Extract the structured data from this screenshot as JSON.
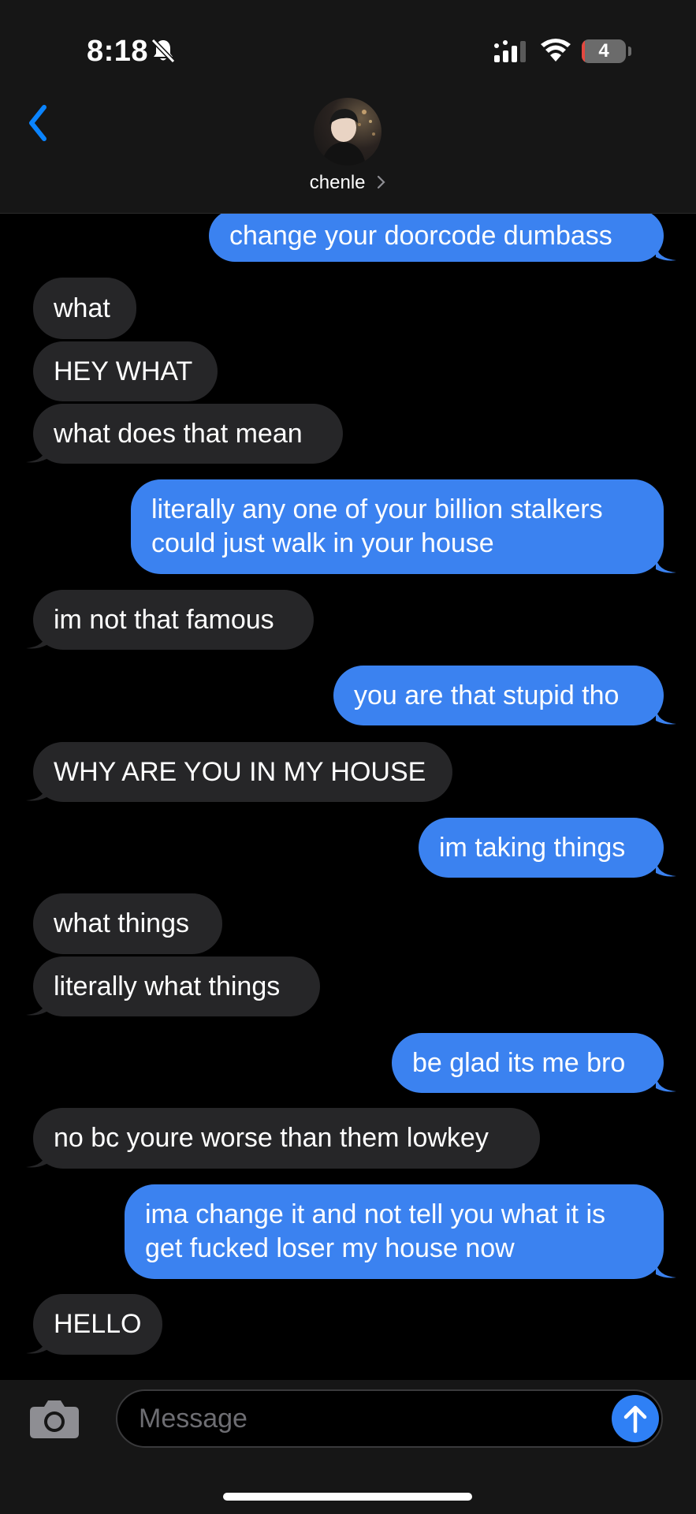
{
  "status_bar": {
    "time": "8:18",
    "battery_level": "4",
    "battery_fraction": 0.04
  },
  "header": {
    "contact_name": "chenle"
  },
  "messages": [
    {
      "side": "out",
      "text": "change your doorcode dumbass"
    },
    {
      "side": "in",
      "text": "what"
    },
    {
      "side": "in",
      "text": "HEY WHAT"
    },
    {
      "side": "in",
      "text": "what does that mean"
    },
    {
      "side": "out",
      "text": "literally any one of your billion stalkers could just walk in your house"
    },
    {
      "side": "in",
      "text": "im not that famous"
    },
    {
      "side": "out",
      "text": "you are that stupid tho"
    },
    {
      "side": "in",
      "text": "WHY ARE YOU IN MY HOUSE"
    },
    {
      "side": "out",
      "text": "im taking things"
    },
    {
      "side": "in",
      "text": "what things"
    },
    {
      "side": "in",
      "text": "literally what things"
    },
    {
      "side": "out",
      "text": "be glad its me bro"
    },
    {
      "side": "in",
      "text": "no bc youre worse than them lowkey"
    },
    {
      "side": "out",
      "text": "ima change it and not tell you what it is get fucked loser my house now"
    },
    {
      "side": "in",
      "text": "HELLO"
    }
  ],
  "composer": {
    "placeholder": "Message"
  },
  "icons": {
    "back": "chevron-left-icon",
    "silent": "bell-slash-icon",
    "camera": "camera-icon",
    "send": "arrow-up-icon"
  },
  "colors": {
    "outgoing_bubble": "#3b82f0",
    "incoming_bubble": "#262628",
    "accent": "#0a84ff"
  }
}
